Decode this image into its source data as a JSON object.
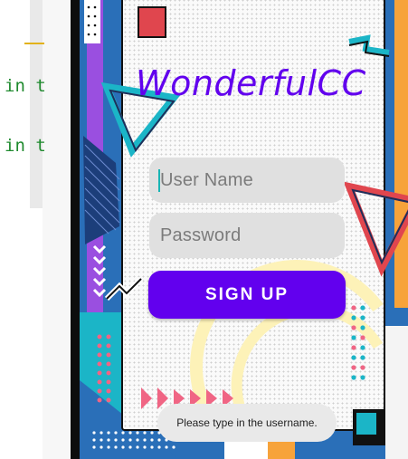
{
  "editor": {
    "code_lines": [
      "in t",
      "in t"
    ]
  },
  "app": {
    "title": "WonderfulCC",
    "username": {
      "placeholder": "User Name",
      "value": ""
    },
    "password": {
      "placeholder": "Password",
      "value": ""
    },
    "signup_label": "SIGN UP",
    "toast": "Please type in the username."
  },
  "colors": {
    "accent": "#6200ee",
    "field_bg": "#e0e0e0",
    "screen_blue": "#2a6fb8",
    "teal": "#1bb5c7",
    "coral": "#e0464e",
    "pink": "#f06584",
    "orange": "#f7a33a",
    "purple_panel": "#9a4fe0"
  }
}
